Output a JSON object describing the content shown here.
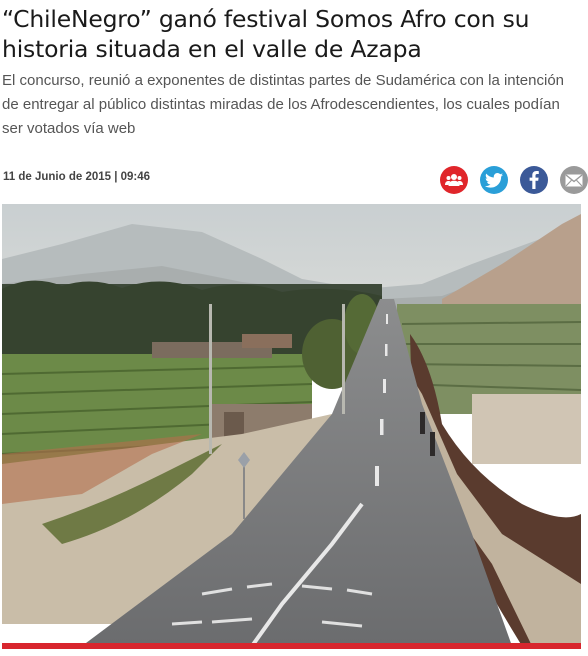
{
  "article": {
    "title": "“ChileNegro” ganó festival Somos Afro con su historia situada en el valle de Azapa",
    "lead": "El concurso, reunió a exponentes de distintas partes de Sudamérica con la intención de entregar al público distintas miradas de los Afrodescendientes, los cuales podían ser votados vía web",
    "date": "11 de Junio de 2015 | 09:46"
  },
  "share": [
    {
      "icon": "group-icon",
      "color": "#e0262b"
    },
    {
      "icon": "twitter-icon",
      "color": "#2a9fd8"
    },
    {
      "icon": "facebook-icon",
      "color": "#3b5998"
    },
    {
      "icon": "email-icon",
      "color": "#9a9a9a"
    }
  ],
  "hero_image": {
    "subject": "valley-road-photo",
    "border_color": "#d8262e"
  }
}
